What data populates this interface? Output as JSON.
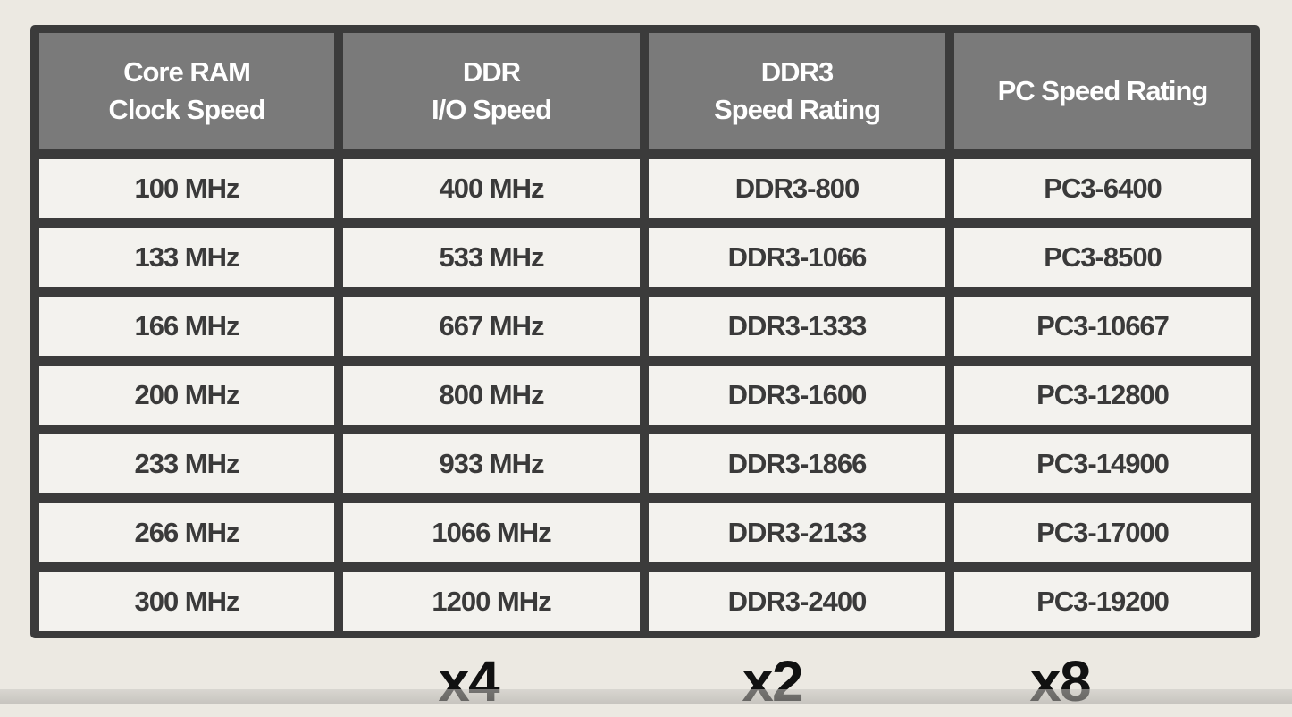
{
  "table": {
    "headers": [
      "Core RAM\nClock Speed",
      "DDR\nI/O Speed",
      "DDR3\nSpeed Rating",
      "PC Speed Rating"
    ],
    "rows": [
      [
        "100 MHz",
        "400 MHz",
        "DDR3-800",
        "PC3-6400"
      ],
      [
        "133 MHz",
        "533 MHz",
        "DDR3-1066",
        "PC3-8500"
      ],
      [
        "166 MHz",
        "667 MHz",
        "DDR3-1333",
        "PC3-10667"
      ],
      [
        "200 MHz",
        "800 MHz",
        "DDR3-1600",
        "PC3-12800"
      ],
      [
        "233 MHz",
        "933 MHz",
        "DDR3-1866",
        "PC3-14900"
      ],
      [
        "266 MHz",
        "1066 MHz",
        "DDR3-2133",
        "PC3-17000"
      ],
      [
        "300 MHz",
        "1200 MHz",
        "DDR3-2400",
        "PC3-19200"
      ]
    ]
  },
  "multipliers": [
    "x4",
    "x2",
    "x8"
  ],
  "colors": {
    "background": "#ece9e2",
    "frame": "#3b3b3b",
    "header_fill": "#7a7a7a",
    "header_text": "#ffffff",
    "cell_fill": "#f3f2ee",
    "cell_text": "#3a3a3a",
    "multiplier_text": "#111111"
  }
}
